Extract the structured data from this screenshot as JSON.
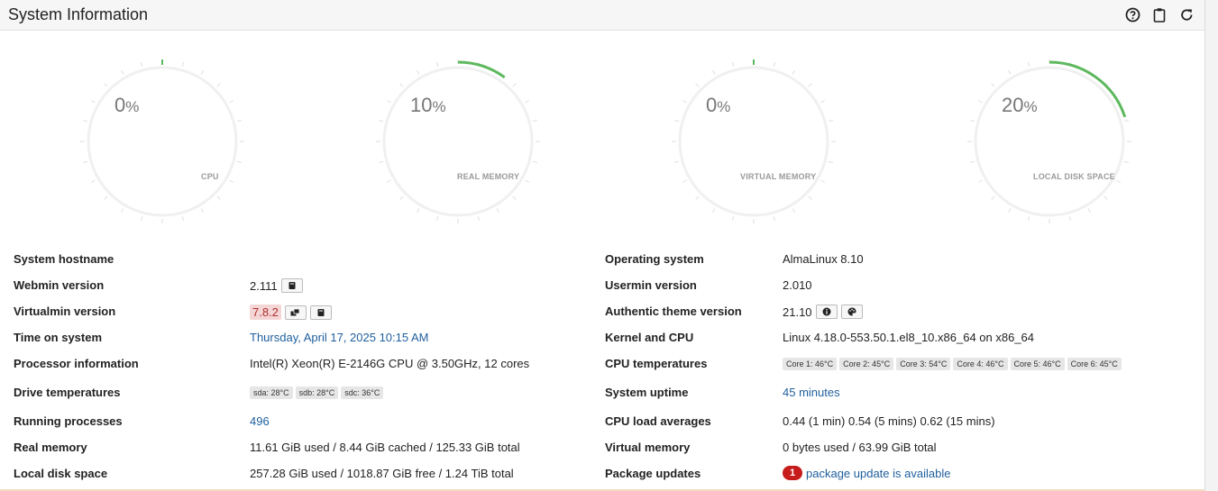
{
  "header": {
    "title": "System Information"
  },
  "gauges": [
    {
      "value": "0",
      "unit": "%",
      "label": "CPU",
      "fraction": 0.0
    },
    {
      "value": "10",
      "unit": "%",
      "label": "REAL MEMORY",
      "fraction": 0.1
    },
    {
      "value": "0",
      "unit": "%",
      "label": "VIRTUAL MEMORY",
      "fraction": 0.0
    },
    {
      "value": "20",
      "unit": "%",
      "label": "LOCAL DISK SPACE",
      "fraction": 0.2
    }
  ],
  "colors": {
    "accent": "#5cb85c",
    "link": "#1f5f9e",
    "alert": "#c71c1c"
  },
  "left": {
    "hostname": {
      "label": "System hostname",
      "value": ""
    },
    "webmin": {
      "label": "Webmin version",
      "value": "2.111"
    },
    "virtualmin": {
      "label": "Virtualmin version",
      "value": "7.8.2"
    },
    "time": {
      "label": "Time on system",
      "value": "Thursday, April 17, 2025 10:15 AM"
    },
    "processor": {
      "label": "Processor information",
      "value": "Intel(R) Xeon(R) E-2146G CPU @ 3.50GHz, 12 cores"
    },
    "drive_temps": {
      "label": "Drive temperatures",
      "chips": [
        "sda: 28°C",
        "sdb: 28°C",
        "sdc: 36°C"
      ]
    },
    "processes": {
      "label": "Running processes",
      "value": "496"
    },
    "real_memory": {
      "label": "Real memory",
      "value": "11.61 GiB used / 8.44 GiB cached / 125.33 GiB total"
    },
    "disk": {
      "label": "Local disk space",
      "value": "257.28 GiB used / 1018.87 GiB free / 1.24 TiB total"
    }
  },
  "right": {
    "os": {
      "label": "Operating system",
      "value": "AlmaLinux 8.10"
    },
    "usermin": {
      "label": "Usermin version",
      "value": "2.010"
    },
    "theme": {
      "label": "Authentic theme version",
      "value": "21.10"
    },
    "kernel": {
      "label": "Kernel and CPU",
      "value": "Linux 4.18.0-553.50.1.el8_10.x86_64 on x86_64"
    },
    "cpu_temps": {
      "label": "CPU temperatures",
      "chips": [
        "Core 1: 46°C",
        "Core 2: 45°C",
        "Core 3: 54°C",
        "Core 4: 46°C",
        "Core 5: 46°C",
        "Core 6: 45°C"
      ]
    },
    "uptime": {
      "label": "System uptime",
      "value": "45 minutes"
    },
    "load": {
      "label": "CPU load averages",
      "value": "0.44 (1 min) 0.54 (5 mins) 0.62 (15 mins)"
    },
    "virtual_memory": {
      "label": "Virtual memory",
      "value": "0 bytes used / 63.99 GiB total"
    },
    "packages": {
      "label": "Package updates",
      "count": "1",
      "value": "package update is available"
    }
  }
}
